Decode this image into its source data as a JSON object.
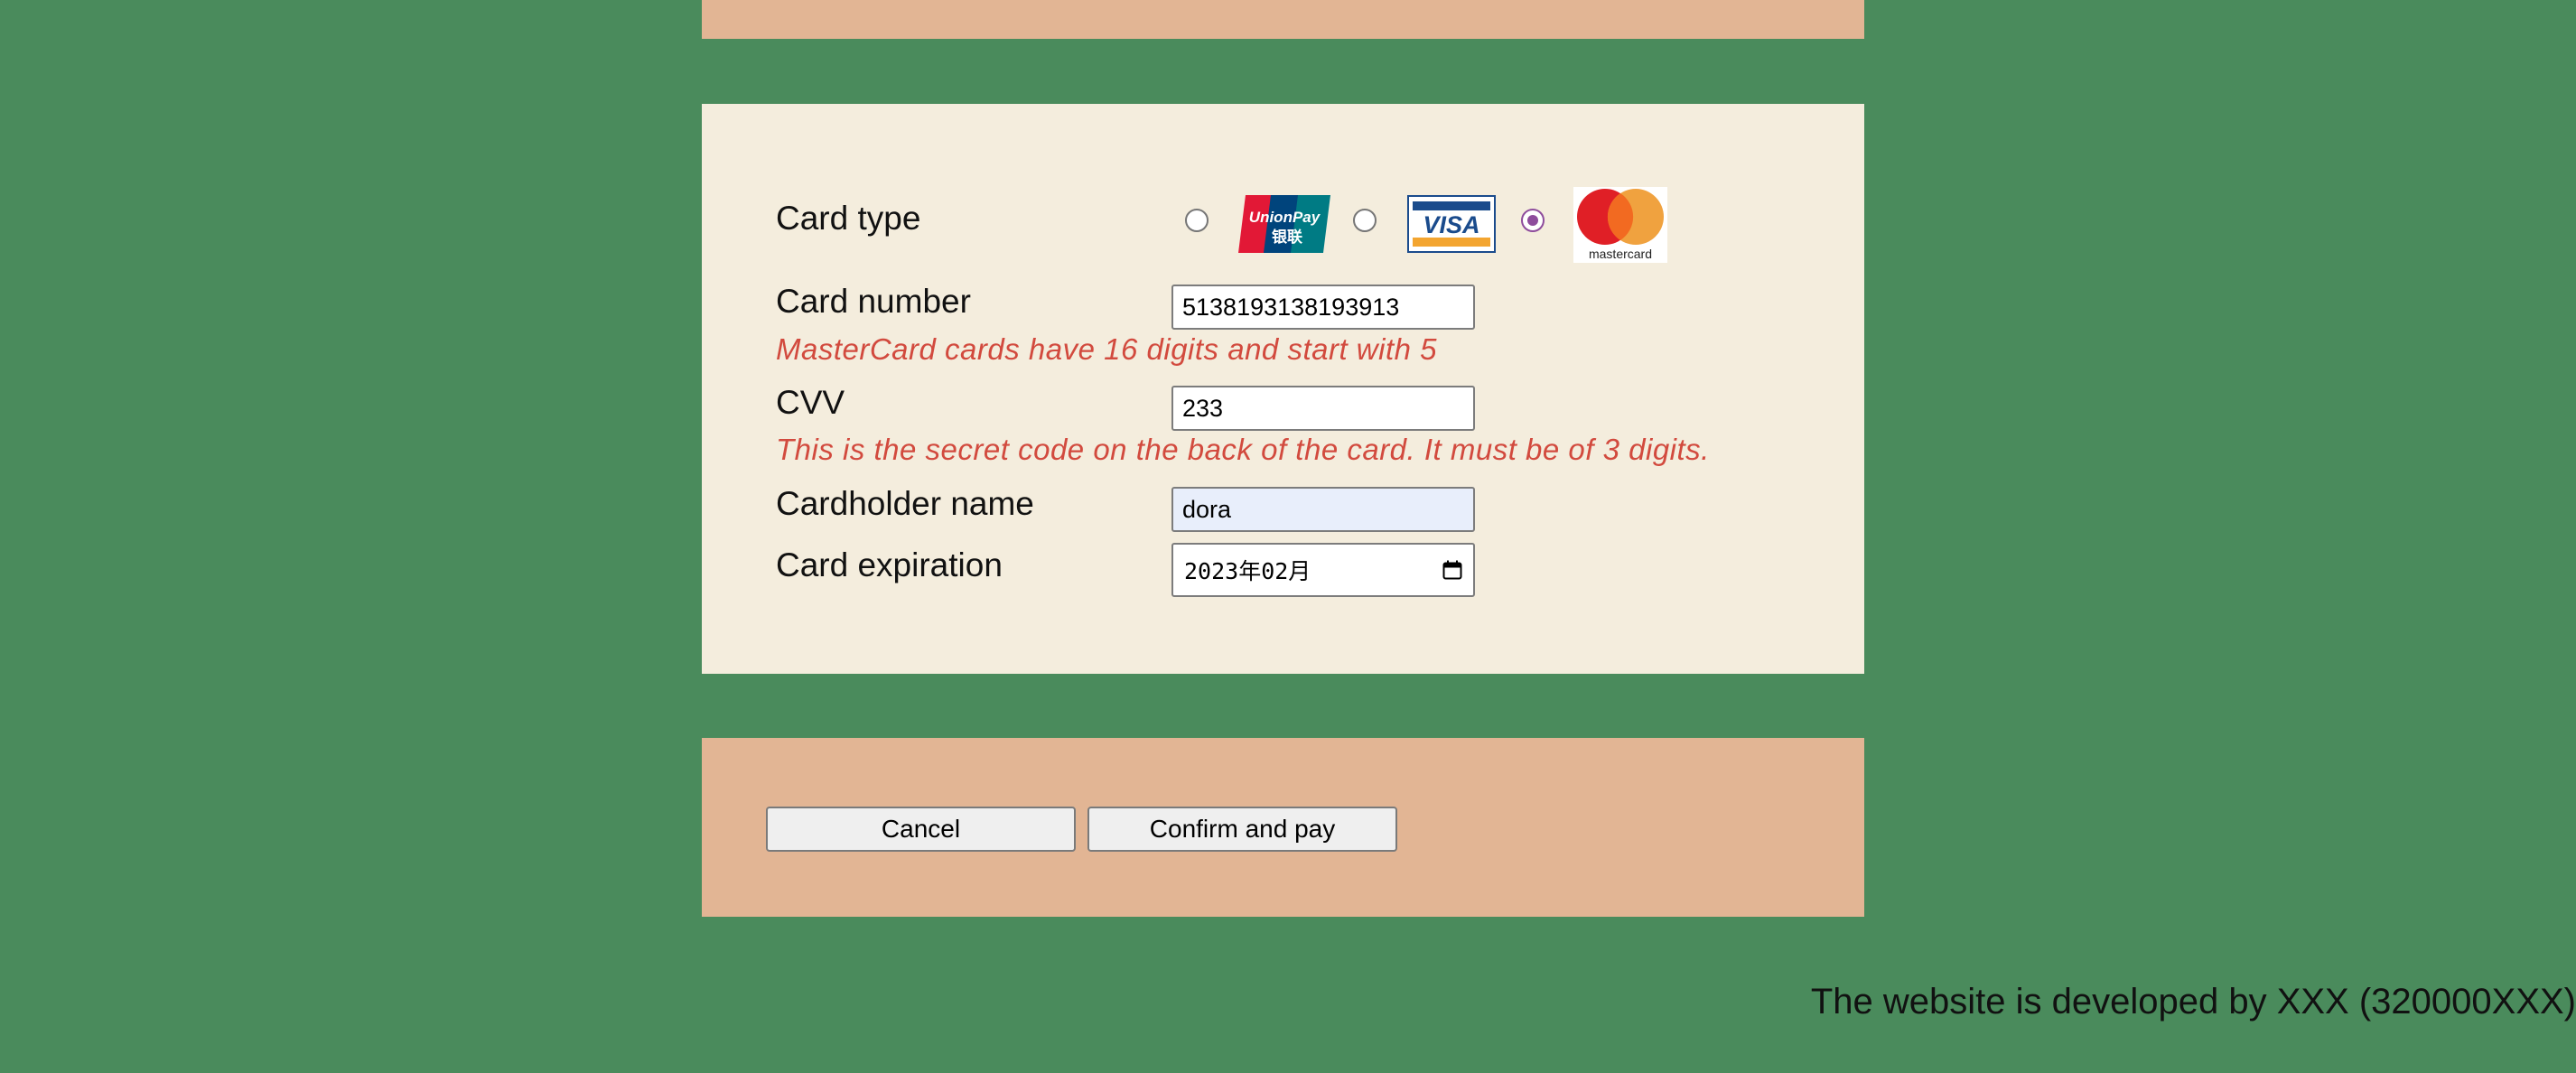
{
  "form": {
    "card_type_label": "Card type",
    "card_types": [
      {
        "name": "UnionPay",
        "logo_text": "UnionPay",
        "logo_subtext": "银联",
        "selected": false
      },
      {
        "name": "Visa",
        "logo_text": "VISA",
        "selected": false
      },
      {
        "name": "MasterCard",
        "logo_text": "mastercard",
        "selected": true
      }
    ],
    "card_number_label": "Card number",
    "card_number_value": "5138193138193913",
    "card_number_hint": "MasterCard cards have 16 digits and start with 5",
    "cvv_label": "CVV",
    "cvv_value": "233",
    "cvv_hint": "This is the secret code on the back of the card. It must be of 3 digits.",
    "cardholder_label": "Cardholder name",
    "cardholder_value": "dora",
    "expiration_label": "Card expiration",
    "expiration_value": "2023年02月"
  },
  "actions": {
    "cancel_label": "Cancel",
    "confirm_label": "Confirm and pay"
  },
  "footer": {
    "text": "The website is developed by XXX (320000XXX)"
  },
  "colors": {
    "page_background": "#4a8b5c",
    "card_panel": "#f4eddd",
    "button_panel": "#e2b594",
    "hint_text": "#d24a3e",
    "radio_checked": "#8e4c9c",
    "autofill_field": "#e8eefb"
  },
  "icons": [
    "unionpay-logo",
    "visa-logo",
    "mastercard-logo",
    "calendar-icon"
  ]
}
